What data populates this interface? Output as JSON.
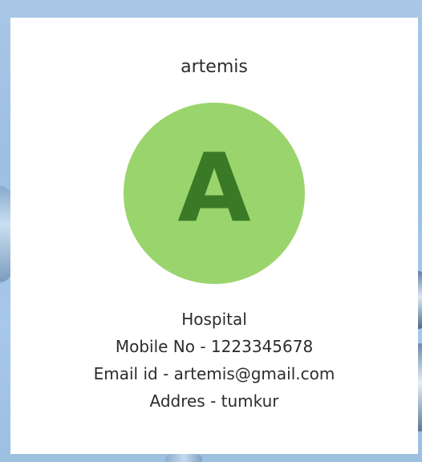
{
  "profile": {
    "name": "artemis",
    "avatar_letter": "A",
    "type": "Hospital",
    "mobile_line": "Mobile No - 1223345678",
    "email_line": "Email id - artemis@gmail.com",
    "address_line": "Addres - tumkur"
  },
  "colors": {
    "avatar_fill": "#9ad46d",
    "avatar_letter": "#3a7a27"
  }
}
